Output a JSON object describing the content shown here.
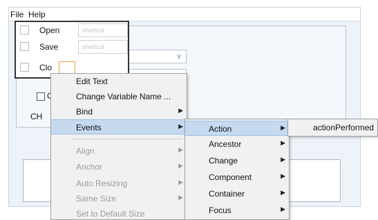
{
  "menubar": {
    "file_label": "File",
    "help_label": "Help"
  },
  "file_menu": {
    "items": [
      {
        "label": "Open",
        "shortcut": "shortcut"
      },
      {
        "label": "Save",
        "shortcut": "shortcut"
      },
      {
        "label": "Clo"
      }
    ]
  },
  "panel": {
    "checkbox_label": "C",
    "label_ch": "CH"
  },
  "context_menu": {
    "items": [
      {
        "label": "Edit Text"
      },
      {
        "label": "Change Variable Name ..."
      },
      {
        "label": "Bind"
      },
      {
        "label": "Events"
      },
      {
        "label": "Align"
      },
      {
        "label": "Anchor"
      },
      {
        "label": "Auto Resizing"
      },
      {
        "label": "Same Size"
      },
      {
        "label": "Set to Default Size"
      }
    ]
  },
  "events_submenu": {
    "items": [
      {
        "label": "Action"
      },
      {
        "label": "Ancestor"
      },
      {
        "label": "Change"
      },
      {
        "label": "Component"
      },
      {
        "label": "Container"
      },
      {
        "label": "Focus"
      }
    ]
  },
  "action_submenu": {
    "items": [
      {
        "label": "actionPerformed"
      }
    ]
  },
  "colors": {
    "highlight": "#c5d9ef",
    "window_bg": "#eef3f9",
    "menu_bg": "#f1f1f1"
  },
  "icons": {
    "submenu_arrow": "triangle-right-icon",
    "combo_arrow": "chevron-down-icon"
  }
}
